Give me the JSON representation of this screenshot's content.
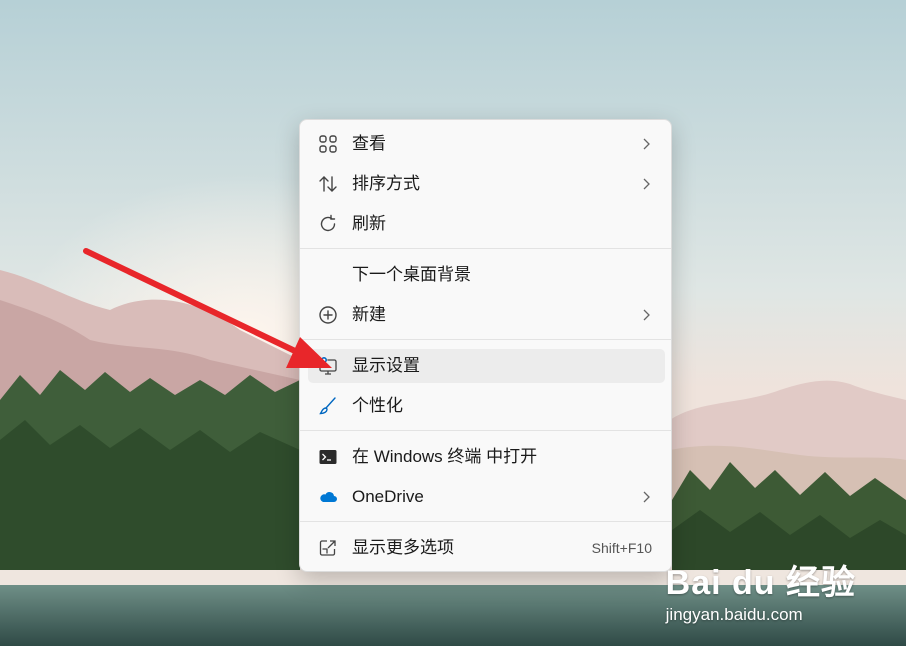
{
  "menu": {
    "items": [
      {
        "label": "查看",
        "icon": "grid-view-icon",
        "submenu": true
      },
      {
        "label": "排序方式",
        "icon": "sort-arrows-icon",
        "submenu": true
      },
      {
        "label": "刷新",
        "icon": "refresh-icon",
        "submenu": false
      },
      {
        "label": "下一个桌面背景",
        "icon": "",
        "submenu": false
      },
      {
        "label": "新建",
        "icon": "plus-circle-icon",
        "submenu": true
      },
      {
        "label": "显示设置",
        "icon": "display-settings-icon",
        "submenu": false
      },
      {
        "label": "个性化",
        "icon": "paint-brush-icon",
        "submenu": false
      },
      {
        "label": "在 Windows 终端 中打开",
        "icon": "terminal-icon",
        "submenu": false
      },
      {
        "label": "OneDrive",
        "icon": "onedrive-cloud-icon",
        "submenu": true
      },
      {
        "label": "显示更多选项",
        "icon": "show-more-icon",
        "submenu": false,
        "shortcut": "Shift+F10"
      }
    ]
  },
  "watermark": {
    "brand": "Bai du 经验",
    "site": "jingyan.baidu.com"
  },
  "colors": {
    "accent": "#0067c0",
    "arrow": "#e8262a",
    "menu_bg": "#f9f9f9",
    "hover_bg": "#ececec"
  }
}
